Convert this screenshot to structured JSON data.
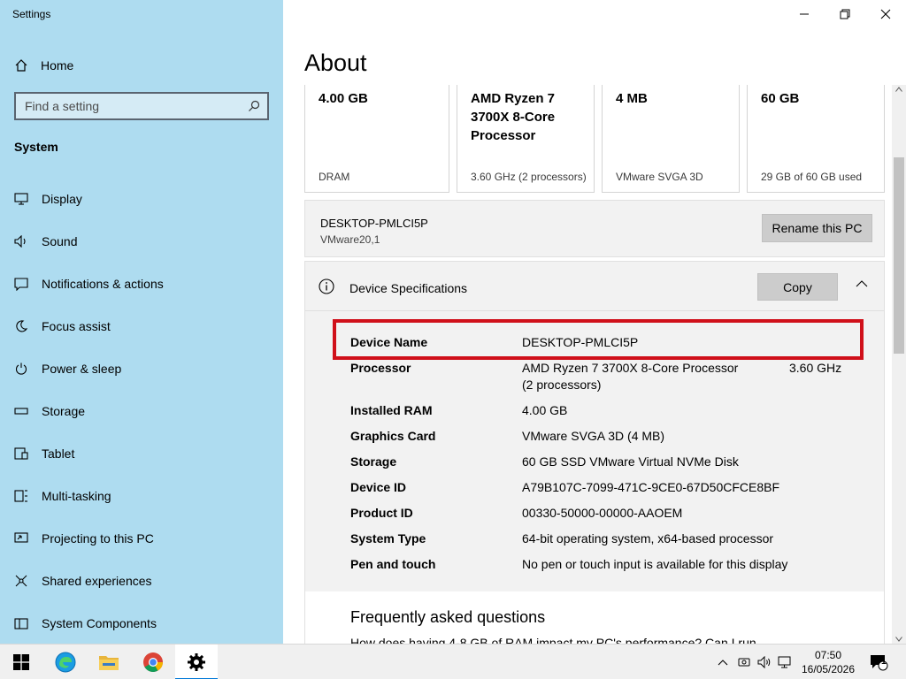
{
  "window": {
    "app_title": "Settings"
  },
  "sidebar": {
    "home_label": "Home",
    "search_placeholder": "Find a setting",
    "section_label": "System",
    "items": [
      {
        "label": "Display",
        "icon": "display-icon"
      },
      {
        "label": "Sound",
        "icon": "sound-icon"
      },
      {
        "label": "Notifications & actions",
        "icon": "notifications-icon"
      },
      {
        "label": "Focus assist",
        "icon": "moon-icon"
      },
      {
        "label": "Power & sleep",
        "icon": "power-icon"
      },
      {
        "label": "Storage",
        "icon": "storage-icon"
      },
      {
        "label": "Tablet",
        "icon": "tablet-icon"
      },
      {
        "label": "Multi-tasking",
        "icon": "multitasking-icon"
      },
      {
        "label": "Projecting to this PC",
        "icon": "projecting-icon"
      },
      {
        "label": "Shared experiences",
        "icon": "shared-icon"
      },
      {
        "label": "System Components",
        "icon": "components-icon"
      }
    ]
  },
  "main": {
    "title": "About",
    "cards": [
      {
        "value": "4.00 GB",
        "label": "DRAM"
      },
      {
        "value": "AMD Ryzen 7 3700X 8-Core Processor",
        "label": "3.60 GHz (2 processors)"
      },
      {
        "value": "4 MB",
        "label": "VMware SVGA 3D"
      },
      {
        "value": "60 GB",
        "label": "29 GB of 60 GB used"
      }
    ],
    "pc": {
      "name": "DESKTOP-PMLCI5P",
      "model": "VMware20,1",
      "rename_label": "Rename this PC"
    },
    "specs": {
      "title": "Device Specifications",
      "copy_label": "Copy",
      "rows": [
        {
          "key": "Device Name",
          "value": "DESKTOP-PMLCI5P"
        },
        {
          "key": "Processor",
          "value": "AMD Ryzen 7 3700X 8-Core Processor",
          "value2": "(2 processors)",
          "extra": "3.60 GHz"
        },
        {
          "key": "Installed RAM",
          "value": "4.00 GB"
        },
        {
          "key": "Graphics Card",
          "value": "VMware SVGA 3D (4 MB)"
        },
        {
          "key": "Storage",
          "value": "60 GB SSD VMware Virtual NVMe Disk"
        },
        {
          "key": "Device ID",
          "value": "A79B107C-7099-471C-9CE0-67D50CFCE8BF"
        },
        {
          "key": "Product ID",
          "value": "00330-50000-00000-AAOEM"
        },
        {
          "key": "System Type",
          "value": "64-bit operating system, x64-based processor"
        },
        {
          "key": "Pen and touch",
          "value": "No pen or touch input is available for this display"
        }
      ]
    },
    "faq": {
      "title": "Frequently asked questions",
      "question": "How does having 4-8 GB of RAM impact my PC's performance? Can I run"
    }
  },
  "taskbar": {
    "time": "07:50",
    "date": "16/05/2026",
    "notification_count": "1",
    "colors": {
      "accent": "#0078d7",
      "highlight": "#d0101a",
      "sidebar": "#aedcf0"
    }
  }
}
